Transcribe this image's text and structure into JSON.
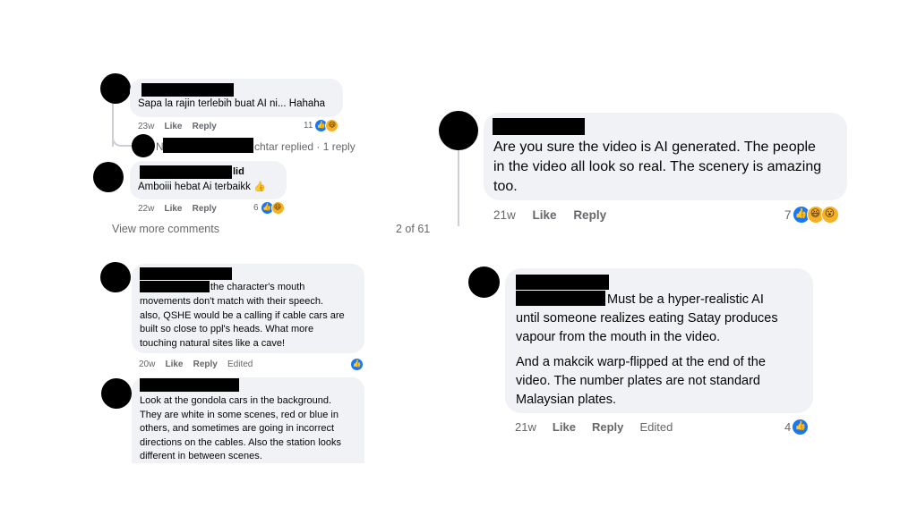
{
  "panel1": {
    "comment1": {
      "text": "Sapa la rajin terlebih buat AI ni... Hahaha",
      "time": "23w",
      "like": "Like",
      "reply": "Reply",
      "reactions": "11"
    },
    "replies_link": {
      "prefix": "N",
      "suffix": "chtar replied · 1 reply"
    },
    "comment2": {
      "name_suffix": "lid",
      "text": "Amboiii hebat Ai terbaikk",
      "time": "22w",
      "like": "Like",
      "reply": "Reply",
      "reactions": "6"
    },
    "view_more": "View more comments",
    "page_count": "2 of 61"
  },
  "panel2": {
    "text_lines": [
      "Are you sure the video is AI generated. The people",
      "in the video all look so real. The scenery is amazing",
      "too."
    ],
    "time": "21w",
    "like": "Like",
    "reply": "Reply",
    "reactions": "7"
  },
  "panel3": {
    "comment1": {
      "text_lines": [
        "the character's mouth",
        "movements don't match with their speech.",
        "also, QSHE would be a calling if cable cars are",
        "built so close to ppl's heads. What more",
        "touching natural sites like a cave!"
      ],
      "time": "20w",
      "like": "Like",
      "reply": "Reply",
      "edited": "Edited"
    },
    "comment2": {
      "text_lines": [
        "Look at the gondola cars in the background.",
        "They are white in some scenes, red or blue in",
        "others, and sometimes are going in incorrect",
        "directions on the cables. Also the station looks",
        "different in between scenes."
      ]
    }
  },
  "panel4": {
    "text_lines": [
      "Must be a hyper-realistic AI",
      "until someone realizes eating Satay produces",
      "vapour from the mouth in the video."
    ],
    "text_lines2": [
      "And a makcik warp-flipped at the end of the",
      "video. The number plates are not standard",
      "Malaysian plates."
    ],
    "time": "21w",
    "like": "Like",
    "reply": "Reply",
    "edited": "Edited",
    "reactions": "4"
  },
  "icons": {
    "like": "like-reaction-icon",
    "haha": "haha-reaction-icon",
    "wow": "wow-reaction-icon",
    "hand": "hand-emoji-icon"
  },
  "colors": {
    "like_blue": "#1877f2",
    "bubble": "#f0f2f5",
    "meta": "#65676b"
  }
}
